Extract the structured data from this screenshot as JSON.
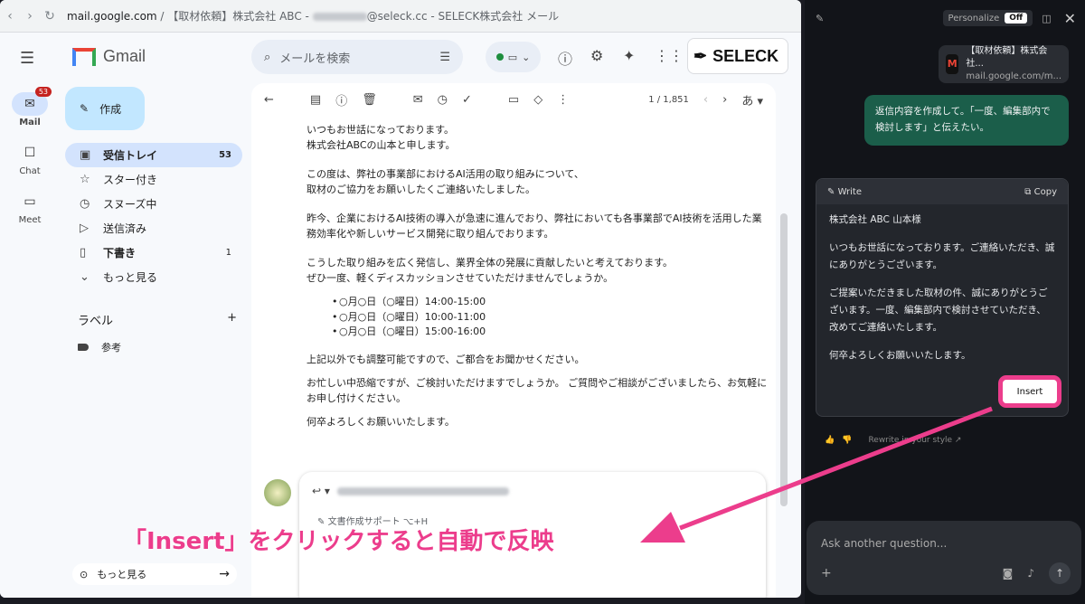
{
  "browser": {
    "url_host": "mail.google.com",
    "url_rest": " / 【取材依頼】株式会社 ABC - ",
    "url_tail": "@seleck.cc - SELECK株式会社 メール"
  },
  "rail": {
    "mail_label": "Mail",
    "mail_badge": "53",
    "chat_label": "Chat",
    "meet_label": "Meet"
  },
  "sidebar": {
    "brand": "Gmail",
    "compose": "作成",
    "items": [
      {
        "icon": "inbox-icon",
        "label": "受信トレイ",
        "count": "53"
      },
      {
        "icon": "star-icon",
        "label": "スター付き",
        "count": ""
      },
      {
        "icon": "clock-icon",
        "label": "スヌーズ中",
        "count": ""
      },
      {
        "icon": "send-icon",
        "label": "送信済み",
        "count": ""
      },
      {
        "icon": "draft-icon",
        "label": "下書き",
        "count": "1"
      },
      {
        "icon": "chevron-down-icon",
        "label": "もっと見る",
        "count": ""
      }
    ],
    "labels_heading": "ラベル",
    "labels": [
      "参考"
    ],
    "more_bottom": "もっと見る"
  },
  "header": {
    "search_placeholder": "メールを検索",
    "account_brand": "SELECK"
  },
  "toolbar": {
    "pager": "1 / 1,851",
    "lang": "あ"
  },
  "email": {
    "paragraphs": [
      [
        "いつもお世話になっております。",
        "株式会社ABCの山本と申します。"
      ],
      [
        "この度は、弊社の事業部におけるAI活用の取り組みについて、",
        "取材のご協力をお願いしたくご連絡いたしました。"
      ],
      [
        "昨今、企業におけるAI技術の導入が急速に進んでおり、弊社においても各事業部でAI技術を活用した業",
        "務効率化や新しいサービス開発に取り組んでおります。"
      ],
      [
        "こうした取り組みを広く発信し、業界全体の発展に貢献したいと考えております。",
        "ぜひ一度、軽くディスカッションさせていただけませんでしょうか。"
      ]
    ],
    "slots": [
      "○月○日（○曜日）14:00-15:00",
      "○月○日（○曜日）10:00-11:00",
      "○月○日（○曜日）15:00-16:00"
    ],
    "after": [
      [
        "上記以外でも調整可能ですので、ご都合をお聞かせください。"
      ],
      [
        "お忙しい中恐縮ですが、ご検討いただけますでしょうか。 ご質問やご相談がございましたら、お気軽に",
        "お申し付けください。"
      ],
      [
        "何卒よろしくお願いいたします。"
      ]
    ]
  },
  "reply": {
    "assist": "文書作成サポート",
    "shortcut": "⌥+H"
  },
  "annotation": "「Insert」をクリックすると自動で反映",
  "panel": {
    "personalize": "Personalize",
    "off": "Off",
    "context_title": "【取材依頼】株式会社...",
    "context_url": "mail.google.com/m...",
    "user_message": "返信内容を作成して。「一度、編集部内で検討します」と伝えたい。",
    "write_label": "Write",
    "copy_label": "Copy",
    "draft": [
      "株式会社 ABC 山本様",
      "いつもお世話になっております。ご連絡いただき、誠にありがとうございます。",
      "ご提案いただきました取材の件、誠にありがとうございます。一度、編集部内で検討させていただき、改めてご連絡いたします。",
      "何卒よろしくお願いいたします。"
    ],
    "insert": "Insert",
    "rewrite": "Rewrite in your style ↗",
    "ask_placeholder": "Ask another question..."
  },
  "colors": {
    "accent_pink": "#ec3d8c",
    "user_bubble": "#1b5e4a",
    "gmail_active": "#d3e3fd"
  }
}
